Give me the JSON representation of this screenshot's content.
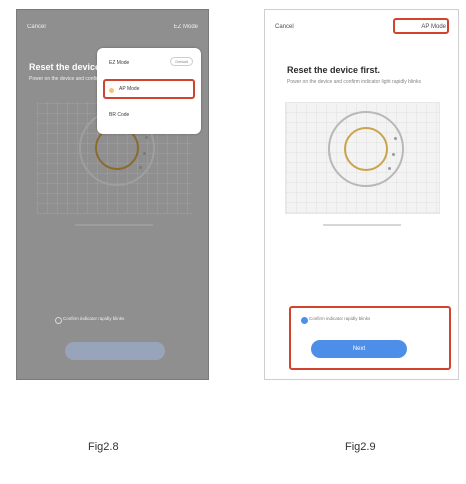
{
  "figures": [
    {
      "id": "left",
      "label": "Fig2.8",
      "top_left": "Cancel",
      "top_right": "EZ Mode",
      "title": "Reset the device first.",
      "subtitle": "Power on the device and confirm indicator light rapidly blinks",
      "illustration_caption": "",
      "dropdown": {
        "items": [
          {
            "label": "EZ Mode",
            "badge": "Default"
          },
          {
            "label": "AP Mode",
            "badge": ""
          },
          {
            "label": "BR Code",
            "badge": ""
          }
        ],
        "selected_index": 1
      },
      "confirm_text": "Confirm indicator rapidly blinks",
      "next_button_label": ""
    },
    {
      "id": "right",
      "label": "Fig2.9",
      "top_left": "Cancel",
      "top_right": "AP Mode",
      "title": "Reset the device first.",
      "subtitle": "Power on the device and confirm indicator light rapidly blinks",
      "illustration_caption": "",
      "confirm_text": "Confirm indicator rapidly blinks",
      "next_button_label": "Next"
    }
  ],
  "colors": {
    "accent_blue": "#4d8fe8",
    "highlight_red": "#d1432d",
    "overlay_gray": "#8f8f8f"
  }
}
